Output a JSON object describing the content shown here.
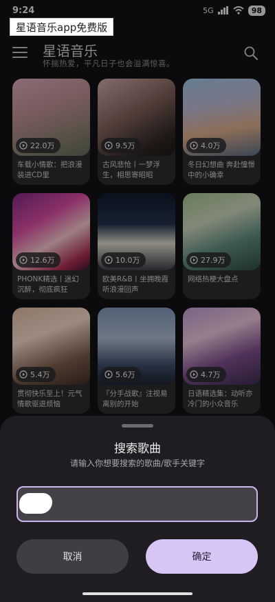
{
  "status_bar": {
    "time": "9:24",
    "network": "5G",
    "battery": "98"
  },
  "watermark": "星语音乐app免费版",
  "header": {
    "title": "星语音乐",
    "subtitle": "怀揣热爱，平凡日子也会溢满惊喜。"
  },
  "playlists": [
    {
      "plays": "22.0万",
      "title": "车载小情歌：把浪漫装进CD里"
    },
    {
      "plays": "9.5万",
      "title": "古风悲怆丨一梦浮生，相思寄昭昭"
    },
    {
      "plays": "4.0万",
      "title": "冬日幻想曲 奔赴憧憬中的小确幸"
    },
    {
      "plays": "12.6万",
      "title": "PHONK精选丨迷幻沉醉，彻底疯狂"
    },
    {
      "plays": "10.0万",
      "title": "欧美R&B丨坐拥晚霞听浪漫回声"
    },
    {
      "plays": "27.9万",
      "title": "网络热梗大盘点"
    },
    {
      "plays": "5.4万",
      "title": "贯彻快乐至上！元气情歌驱退烦恼"
    },
    {
      "plays": "5.6万",
      "title": "『分手战歌』注视易离别的开始"
    },
    {
      "plays": "4.7万",
      "title": "日语精选集：动听亦冷门的小众音乐"
    }
  ],
  "dialog": {
    "title": "搜索歌曲",
    "subtitle": "请输入你想要搜索的歌曲/歌手关键字",
    "input_value": "",
    "cancel_label": "取消",
    "confirm_label": "确定"
  },
  "colors": {
    "accent": "#d7c6f5",
    "sheet_bg": "#1f1d22",
    "input_border": "#c9b7f0"
  }
}
